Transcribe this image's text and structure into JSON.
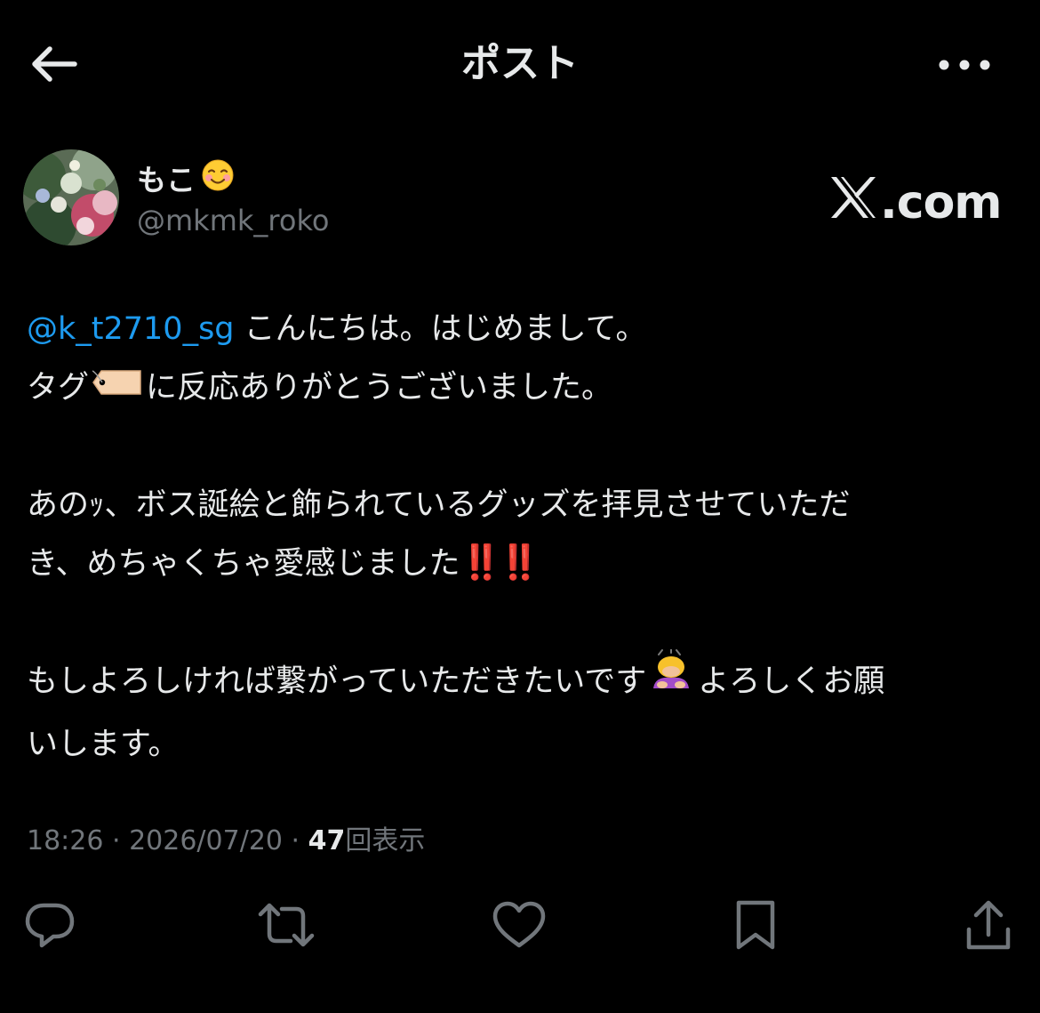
{
  "header": {
    "title": "ポスト",
    "back_icon": "arrow-left-icon",
    "more_icon": "more-horizontal-icon"
  },
  "author": {
    "display_name": "もこ",
    "name_emoji": "☺️",
    "handle": "@mkmk_roko"
  },
  "source_badge": {
    "x_mark": "𝕏",
    "text": ".com"
  },
  "tweet": {
    "mention": "@k_t2710_sg",
    "line1_rest": " こんにちは。はじめまして。",
    "line2_pre": "タグ",
    "line2_emoji": "label-tag-emoji",
    "line2_post": "に反応ありがとうございました。",
    "line3": "あのｯ、ボス誕絵と飾られているグッズを拝見させていただ",
    "line4_text": "き、めちゃくちゃ愛感じました",
    "line4_bangs": "‼️‼️",
    "line5_pre": "もしよろしければ繋がっていただきたいです",
    "line5_emoji": "person-bowing-emoji",
    "line5_post": "よろしくお願",
    "line6": "いします。"
  },
  "meta": {
    "time": "18:26",
    "sep1": " · ",
    "date": "2026/07/20",
    "sep2": " · ",
    "views_count": "47",
    "views_label": "回表示"
  },
  "actions": [
    {
      "icon": "reply-icon"
    },
    {
      "icon": "repost-icon"
    },
    {
      "icon": "like-icon"
    },
    {
      "icon": "bookmark-icon"
    },
    {
      "icon": "share-icon"
    }
  ],
  "colors": {
    "background": "#000000",
    "text": "#e7e9ea",
    "secondary": "#71767b",
    "link": "#1d9bf0",
    "alert": "#e0182d"
  }
}
